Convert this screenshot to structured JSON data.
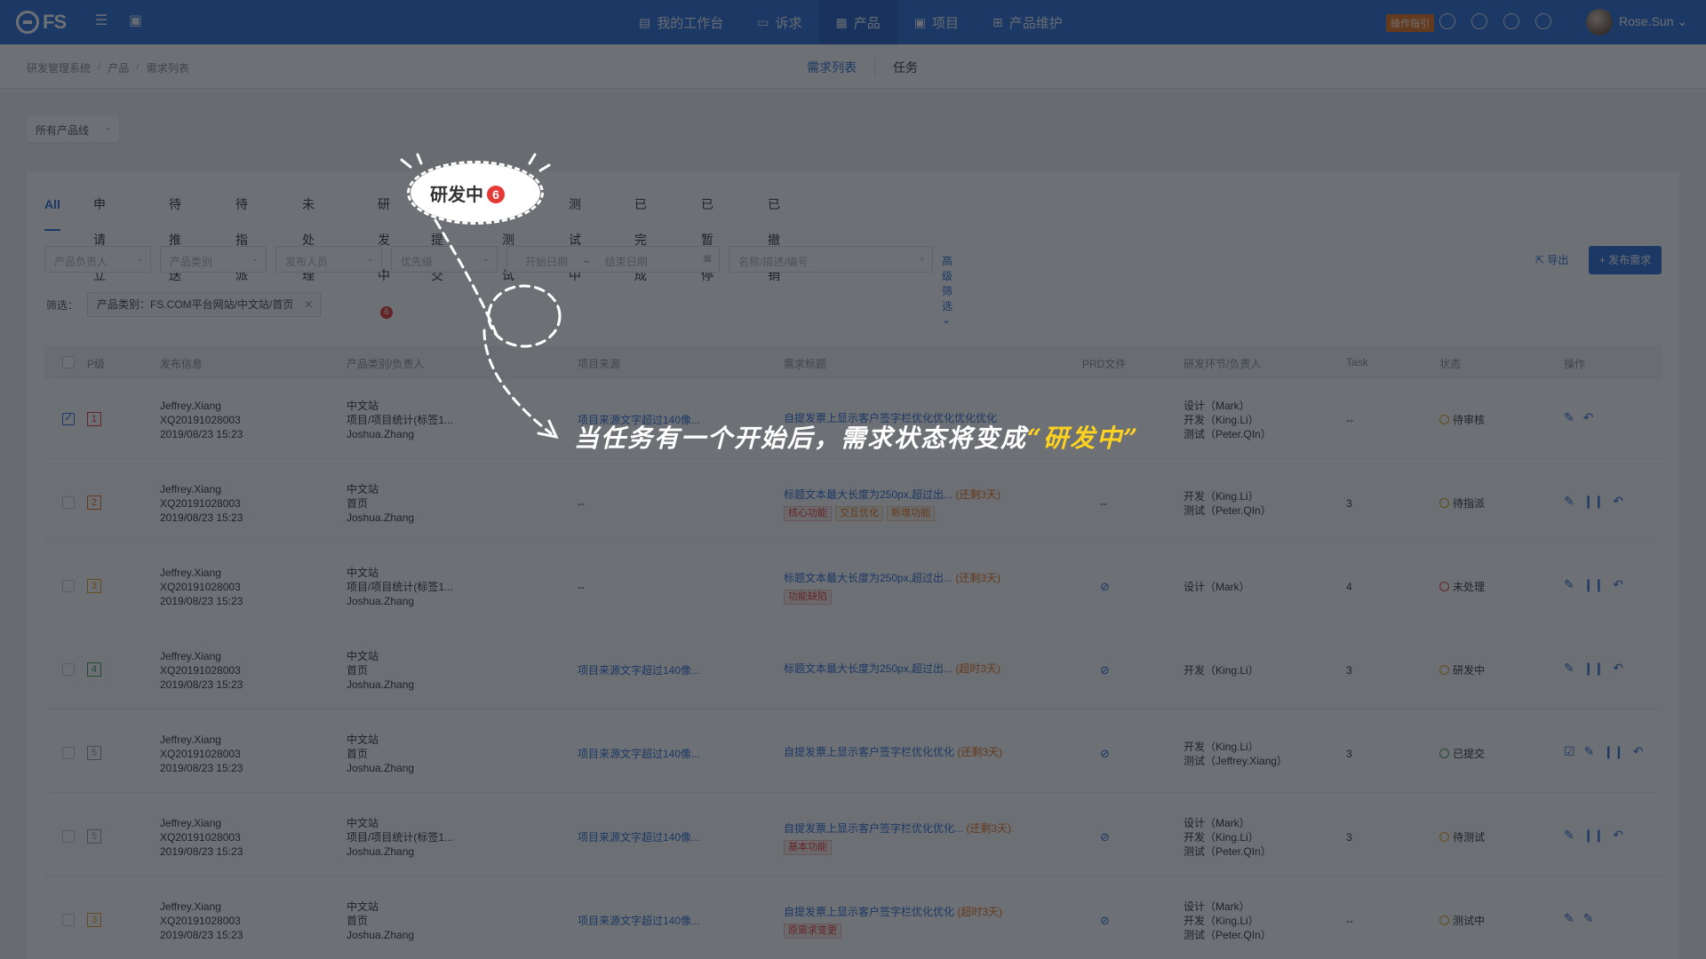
{
  "topnav": {
    "logo": "FS",
    "items": [
      {
        "label": "我的工作台",
        "icon": "monitor-icon"
      },
      {
        "label": "诉求",
        "icon": "inbox-icon"
      },
      {
        "label": "产品",
        "icon": "grid-icon"
      },
      {
        "label": "项目",
        "icon": "briefcase-icon"
      },
      {
        "label": "产品维护",
        "icon": "plus-square-icon"
      }
    ],
    "active": "产品",
    "guide_label": "操作指引",
    "user_name": "Rose.Sun"
  },
  "breadcrumb": [
    "研发管理系统",
    "产品",
    "需求列表"
  ],
  "subtabs": [
    "需求列表",
    "任务"
  ],
  "line_select": "所有产品线",
  "tabs": [
    {
      "label": "All"
    },
    {
      "label": "申请立项"
    },
    {
      "label": "待推送"
    },
    {
      "label": "待指派"
    },
    {
      "label": "未处理"
    },
    {
      "label": "研发中",
      "badge": "6"
    },
    {
      "label": "待提交"
    },
    {
      "label": "待测试"
    },
    {
      "label": "测试中"
    },
    {
      "label": "已完成"
    },
    {
      "label": "已暂停"
    },
    {
      "label": "已撤销"
    }
  ],
  "filters": {
    "product_owner": "产品负责人",
    "product_category": "产品类别",
    "publisher": "发布人员",
    "priority": "优先级",
    "start_date": "开始日期",
    "end_date": "结束日期",
    "date_sep": "~",
    "search_placeholder": "名称/描述/编号",
    "advanced": "高级筛选",
    "export": "导出",
    "publish": "+ 发布需求"
  },
  "active_filter": {
    "label": "筛选：",
    "chip": "产品类别：FS.COM平台网站/中文站/首页"
  },
  "columns": [
    "P级",
    "发布信息",
    "产品类别/负责人",
    "项目来源",
    "需求标题",
    "PRD文件",
    "研发环节/负责人",
    "Task",
    "状态",
    "操作"
  ],
  "rows": [
    {
      "checked": true,
      "prio": "1",
      "prio_color": "#e53935",
      "pub": [
        "Jeffrey.Xiang",
        "XQ20191028003",
        "2019/08/23 15:23"
      ],
      "cat": [
        "中文站",
        "项目/项目统计(标签1...",
        "Joshua.Zhang"
      ],
      "source": "项目来源文字超过140像...",
      "title": "自提发票上显示客户签字栏优化优化优化优化",
      "deadline": "",
      "tags": [],
      "prd": "",
      "stages": [
        "设计（Mark）",
        "开发（King.Li）",
        "测试（Peter.QIn）"
      ],
      "task": "--",
      "status": "待审核",
      "status_kind": "warn",
      "acts": [
        "edit-icon",
        "undo-icon"
      ]
    },
    {
      "checked": false,
      "prio": "2",
      "prio_color": "#e8711d",
      "pub": [
        "Jeffrey.Xiang",
        "XQ20191028003",
        "2019/08/23 15:23"
      ],
      "cat": [
        "中文站",
        "首页",
        "Joshua.Zhang"
      ],
      "source": "--",
      "title": "标题文本最大长度为250px,超过出...",
      "deadline": "(还剩3天)",
      "tags": [
        "核心功能",
        "交互优化",
        "新增功能"
      ],
      "prd": "--",
      "stages": [
        "开发（King.Li）",
        "测试（Peter.QIn）"
      ],
      "task": "3",
      "status": "待指派",
      "status_kind": "warn",
      "acts": [
        "edit-icon",
        "pause-icon",
        "undo-icon"
      ]
    },
    {
      "checked": false,
      "prio": "3",
      "prio_color": "#e8a11d",
      "pub": [
        "Jeffrey.Xiang",
        "XQ20191028003",
        "2019/08/23 15:23"
      ],
      "cat": [
        "中文站",
        "项目/项目统计(标签1...",
        "Joshua.Zhang"
      ],
      "source": "--",
      "title": "标题文本最大长度为250px,超过出...",
      "deadline": "(还剩3天)",
      "tags": [
        "功能缺陷"
      ],
      "prd": "clip",
      "stages": [
        "设计（Mark）"
      ],
      "task": "4",
      "status": "未处理",
      "status_kind": "red",
      "acts": [
        "edit-icon",
        "pause-icon",
        "undo-icon"
      ]
    },
    {
      "checked": false,
      "prio": "4",
      "prio_color": "#43a047",
      "pub": [
        "Jeffrey.Xiang",
        "XQ20191028003",
        "2019/08/23 15:23"
      ],
      "cat": [
        "中文站",
        "首页",
        "Joshua.Zhang"
      ],
      "source": "项目来源文字超过140像...",
      "title": "标题文本最大长度为250px,超过出...",
      "deadline": "(超时3天)",
      "tags": [],
      "prd": "clip",
      "stages": [
        "开发（King.Li）"
      ],
      "task": "3",
      "status": "研发中",
      "status_kind": "warn",
      "acts": [
        "edit-icon",
        "pause-icon",
        "undo-icon"
      ]
    },
    {
      "checked": false,
      "prio": "5",
      "prio_color": "#9e9e9e",
      "pub": [
        "Jeffrey.Xiang",
        "XQ20191028003",
        "2019/08/23 15:23"
      ],
      "cat": [
        "中文站",
        "首页",
        "Joshua.Zhang"
      ],
      "source": "项目来源文字超过140像...",
      "title": "自提发票上显示客户签字栏优化优化",
      "deadline": "(还剩3天)",
      "tags": [],
      "prd": "clip",
      "stages": [
        "开发（King.Li）",
        "测试（Jeffrey.Xiang）"
      ],
      "task": "3",
      "status": "已提交",
      "status_kind": "green",
      "acts": [
        "review-icon",
        "edit-icon",
        "pause-icon",
        "undo-icon"
      ]
    },
    {
      "checked": false,
      "prio": "5",
      "prio_color": "#9e9e9e",
      "pub": [
        "Jeffrey.Xiang",
        "XQ20191028003",
        "2019/08/23 15:23"
      ],
      "cat": [
        "中文站",
        "项目/项目统计(标签1...",
        "Joshua.Zhang"
      ],
      "source": "项目来源文字超过140像...",
      "title": "自提发票上显示客户签字栏优化优化...",
      "deadline": "(还剩3天)",
      "tags": [
        "基本功能"
      ],
      "prd": "clip",
      "stages": [
        "设计（Mark）",
        "开发（King.Li）",
        "测试（Peter.QIn）"
      ],
      "task": "3",
      "status": "待测试",
      "status_kind": "warn",
      "acts": [
        "edit-icon",
        "pause-icon",
        "undo-icon"
      ]
    },
    {
      "checked": false,
      "prio": "3",
      "prio_color": "#e8a11d",
      "pub": [
        "Jeffrey.Xiang",
        "XQ20191028003",
        "2019/08/23 15:23"
      ],
      "cat": [
        "中文站",
        "首页",
        "Joshua.Zhang"
      ],
      "source": "项目来源文字超过140像...",
      "title": "自提发票上显示客户签字栏优化优化",
      "deadline": "(超时3天)",
      "tags": [
        "原需求变更"
      ],
      "prd": "clip",
      "stages": [
        "设计（Mark）",
        "开发（King.Li）",
        "测试（Peter.QIn）"
      ],
      "task": "--",
      "status": "测试中",
      "status_kind": "warn",
      "acts": [
        "edit-icon",
        "edit-icon"
      ]
    }
  ],
  "overlay": {
    "spot_label": "研发中",
    "spot_badge": "6",
    "callout_prefix": "当任务有一个开始后，需求状态将变成",
    "callout_highlight": "“研发中”"
  }
}
